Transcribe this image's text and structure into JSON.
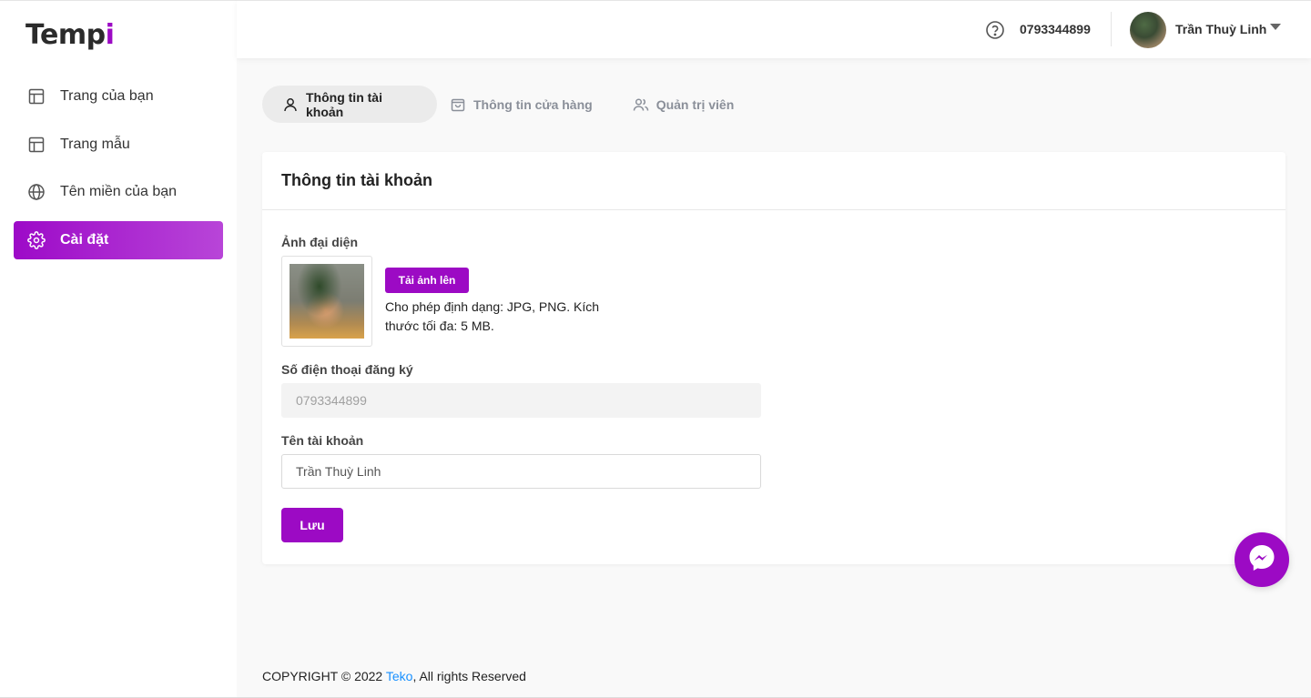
{
  "brand": {
    "logo_main": "Temp",
    "logo_accent": "i",
    "accent_color": "#9c0ac4"
  },
  "sidebar": {
    "items": [
      {
        "label": "Trang của bạn",
        "icon": "layout-icon",
        "active": false
      },
      {
        "label": "Trang mẫu",
        "icon": "layout-icon",
        "active": false
      },
      {
        "label": "Tên miền của bạn",
        "icon": "globe-icon",
        "active": false
      },
      {
        "label": "Cài đặt",
        "icon": "gear-icon",
        "active": true
      }
    ]
  },
  "header": {
    "phone": "0793344899",
    "user_name": "Trần Thuỳ Linh"
  },
  "tabs": [
    {
      "label": "Thông tin tài khoản",
      "icon": "user-icon",
      "active": true
    },
    {
      "label": "Thông tin cửa hàng",
      "icon": "shopping-bag-icon",
      "active": false
    },
    {
      "label": "Quản trị viên",
      "icon": "users-icon",
      "active": false
    }
  ],
  "card": {
    "title": "Thông tin tài khoản",
    "avatar_label": "Ảnh đại diện",
    "upload_button": "Tải ảnh lên",
    "upload_hint": "Cho phép định dạng: JPG, PNG. Kích thước tối đa: 5 MB.",
    "phone_label": "Số điện thoại đăng ký",
    "phone_value": "0793344899",
    "name_label": "Tên tài khoản",
    "name_value": "Trần Thuỳ Linh",
    "save_button": "Lưu"
  },
  "footer": {
    "prefix": "COPYRIGHT © 2022 ",
    "company": "Teko",
    "suffix": ", All rights Reserved"
  }
}
